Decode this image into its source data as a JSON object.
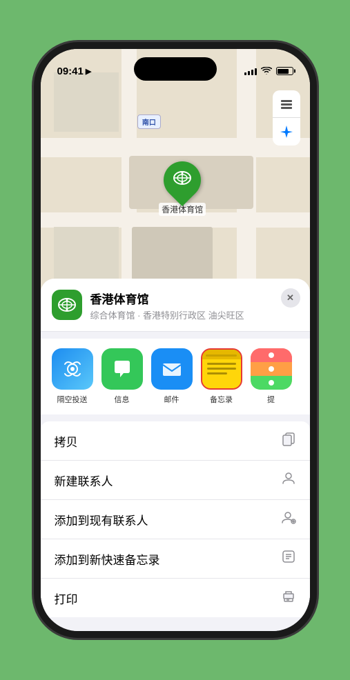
{
  "status_bar": {
    "time": "09:41",
    "location_icon": "▶",
    "battery_percent": 80
  },
  "map": {
    "label_text": "南口",
    "stadium_name": "香港体育馆",
    "stadium_emoji": "🏟️"
  },
  "map_controls": {
    "map_icon": "🗺",
    "location_icon": "➤"
  },
  "place_header": {
    "name": "香港体育馆",
    "subtitle": "综合体育馆 · 香港特别行政区 油尖旺区",
    "close_label": "✕"
  },
  "share_items": [
    {
      "id": "airdrop",
      "label": "隔空投送",
      "emoji": "📡"
    },
    {
      "id": "messages",
      "label": "信息",
      "emoji": "💬"
    },
    {
      "id": "mail",
      "label": "邮件",
      "emoji": "✉️"
    },
    {
      "id": "notes",
      "label": "备忘录",
      "emoji": ""
    },
    {
      "id": "more",
      "label": "提",
      "emoji": ""
    }
  ],
  "action_items": [
    {
      "id": "copy",
      "label": "拷贝",
      "icon": "⎘"
    },
    {
      "id": "new-contact",
      "label": "新建联系人",
      "icon": "👤"
    },
    {
      "id": "add-existing",
      "label": "添加到现有联系人",
      "icon": "👤"
    },
    {
      "id": "quick-note",
      "label": "添加到新快速备忘录",
      "icon": "▣"
    },
    {
      "id": "print",
      "label": "打印",
      "icon": "🖨"
    }
  ]
}
